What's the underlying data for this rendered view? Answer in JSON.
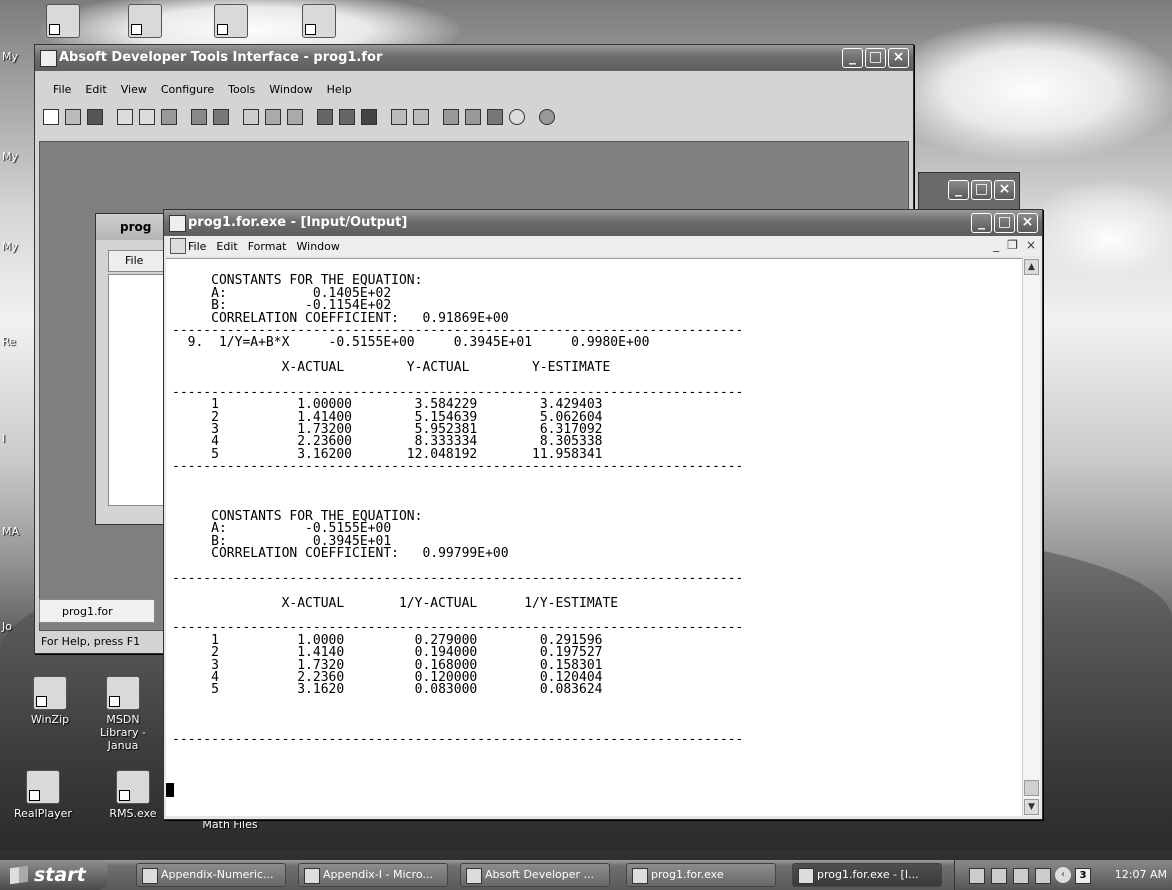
{
  "desktop": {
    "icons": [
      {
        "label": "WinZip"
      },
      {
        "label": "MSDN Library - Janua"
      },
      {
        "label": "RealPlayer"
      },
      {
        "label": "RMS.exe"
      },
      {
        "label": "Math Files"
      }
    ],
    "edge_labels": [
      "My",
      "My",
      "My",
      "Re",
      "I",
      "MA",
      "Jo"
    ]
  },
  "absoft_window": {
    "title": "Absoft Developer Tools Interface - prog1.for",
    "menu": [
      "File",
      "Edit",
      "View",
      "Configure",
      "Tools",
      "Window",
      "Help"
    ],
    "status_text": "For Help, press F1",
    "tab_label": "prog1.for",
    "inner_title": "prog",
    "inner_menu": "File"
  },
  "io_window": {
    "title": "prog1.for.exe - [Input/Output]",
    "menu": [
      "File",
      "Edit",
      "Format",
      "Window"
    ]
  },
  "output_lines": [
    "",
    "     CONSTANTS FOR THE EQUATION:",
    "     A:           0.1405E+02",
    "     B:          -0.1154E+02",
    "     CORRELATION COEFFICIENT:   0.91869E+00",
    "-------------------------------------------------------------------------",
    "  9.  1/Y=A+B*X     -0.5155E+00     0.3945E+01     0.9980E+00",
    "",
    "              X-ACTUAL        Y-ACTUAL        Y-ESTIMATE",
    "",
    "-------------------------------------------------------------------------",
    "     1          1.00000        3.584229        3.429403",
    "     2          1.41400        5.154639        5.062604",
    "     3          1.73200        5.952381        6.317092",
    "     4          2.23600        8.333334        8.305338",
    "     5          3.16200       12.048192       11.958341",
    "-------------------------------------------------------------------------",
    "",
    "",
    "",
    "     CONSTANTS FOR THE EQUATION:",
    "     A:          -0.5155E+00",
    "     B:           0.3945E+01",
    "     CORRELATION COEFFICIENT:   0.99799E+00",
    "",
    "-------------------------------------------------------------------------",
    "",
    "              X-ACTUAL       1/Y-ACTUAL      1/Y-ESTIMATE",
    "",
    "-------------------------------------------------------------------------",
    "     1          1.0000         0.279000        0.291596",
    "     2          1.4140         0.194000        0.197527",
    "     3          1.7320         0.168000        0.158301",
    "     4          2.2360         0.120000        0.120404",
    "     5          3.1620         0.083000        0.083624",
    "",
    "",
    "",
    "-------------------------------------------------------------------------"
  ],
  "taskbar": {
    "start_label": "start",
    "buttons": [
      "Appendix-Numeric...",
      "Appendix-I - Micro...",
      "Absoft Developer ...",
      "prog1.for.exe",
      "prog1.for.exe - [I..."
    ],
    "clock": "12:07 AM",
    "tray_badge": "3"
  }
}
